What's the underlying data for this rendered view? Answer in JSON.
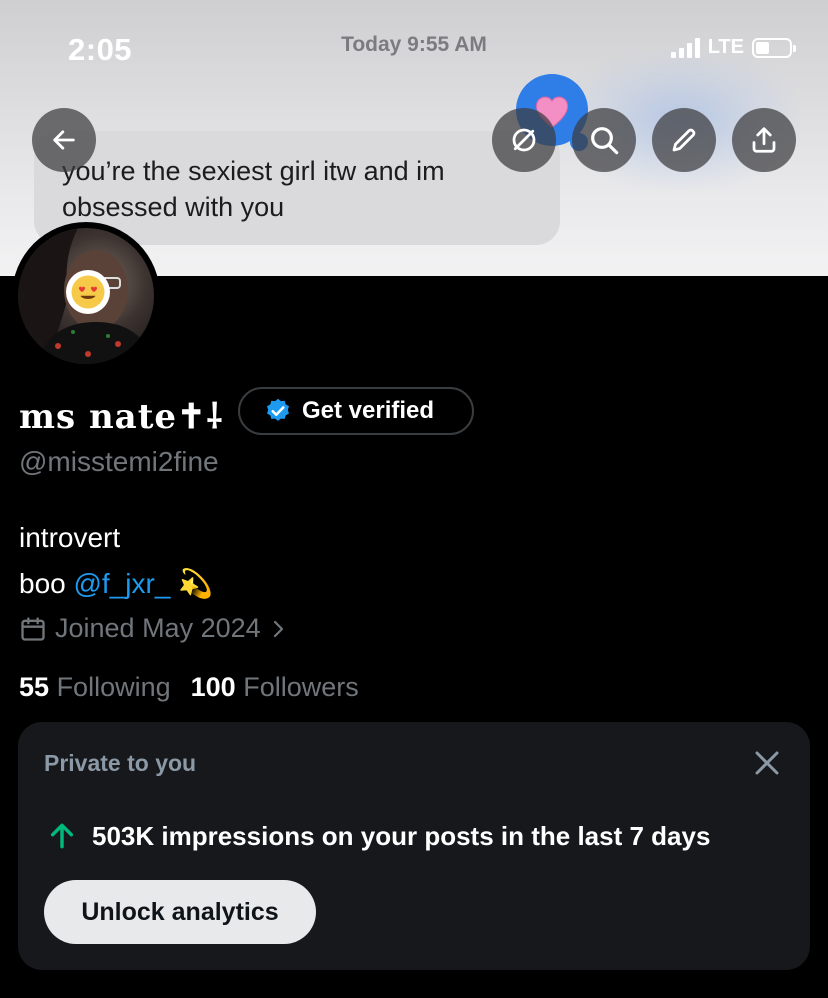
{
  "status_bar": {
    "time": "2:05",
    "date": "Today 9:55 AM",
    "network": "LTE"
  },
  "banner": {
    "dm_text": "you’re the sexiest girl itw and im obsessed with you"
  },
  "header_buttons": [
    "back-icon",
    "grok-icon",
    "search-icon",
    "edit-icon",
    "share-icon"
  ],
  "profile": {
    "display_name": "ms nate✝⸸",
    "verify_label": "Get verified",
    "handle": "@misstemi2fine",
    "bio_line1": "introvert",
    "bio_prefix": "boo",
    "bio_mention": "@f_jxr_",
    "bio_emoji": "💫",
    "joined": "Joined May 2024",
    "following_count": "55",
    "following_label": "Following",
    "followers_count": "100",
    "followers_label": "Followers"
  },
  "private_card": {
    "title": "Private to you",
    "impressions_text": "503K impressions on your posts in the last 7 days",
    "button_label": "Unlock analytics"
  },
  "colors": {
    "accent": "#1d9bf0",
    "verified_badge": "#1d9bf0",
    "impressions_arrow": "#00ba7c",
    "background": "#000000"
  }
}
